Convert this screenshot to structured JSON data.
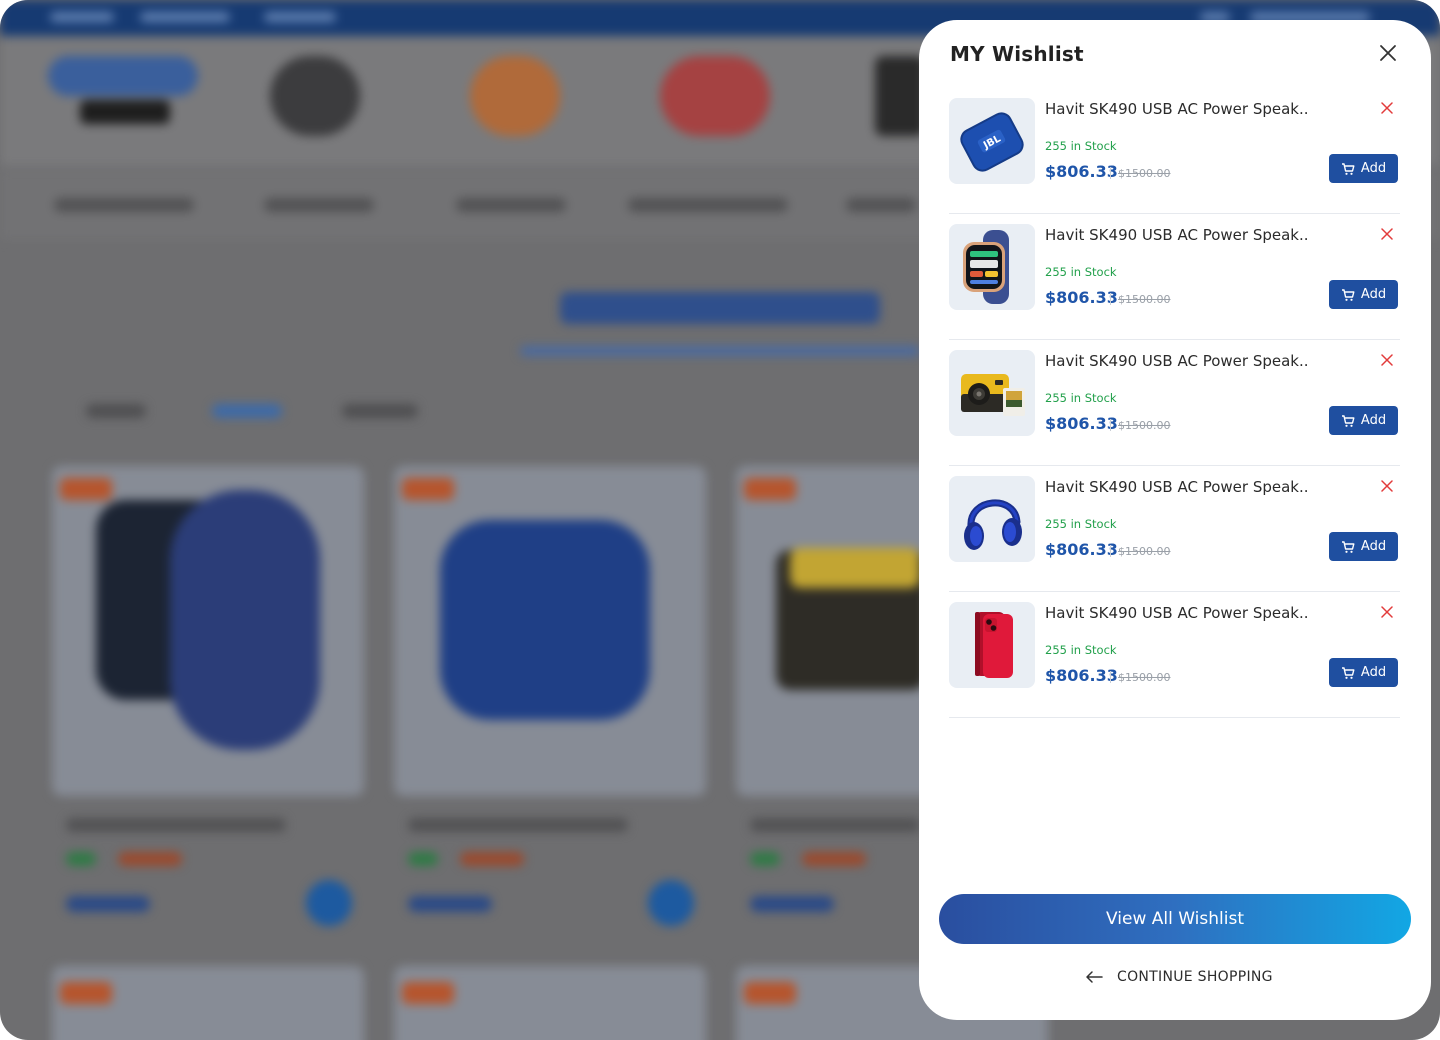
{
  "wishlist": {
    "title": "MY Wishlist",
    "close_icon": "close-icon",
    "items": [
      {
        "name": "Havit SK490 USB AC Power Speak..",
        "stock": "255 in Stock",
        "price": "$806.33",
        "old_price": "$1500.00",
        "add_label": "Add",
        "image": "blue-speaker"
      },
      {
        "name": "Havit SK490 USB AC Power Speak..",
        "stock": "255 in Stock",
        "price": "$806.33",
        "old_price": "$1500.00",
        "add_label": "Add",
        "image": "smartwatch"
      },
      {
        "name": "Havit SK490 USB AC Power Speak..",
        "stock": "255 in Stock",
        "price": "$806.33",
        "old_price": "$1500.00",
        "add_label": "Add",
        "image": "yellow-camera"
      },
      {
        "name": "Havit SK490 USB AC Power Speak..",
        "stock": "255 in Stock",
        "price": "$806.33",
        "old_price": "$1500.00",
        "add_label": "Add",
        "image": "blue-headphones"
      },
      {
        "name": "Havit SK490 USB AC Power Speak..",
        "stock": "255 in Stock",
        "price": "$806.33",
        "old_price": "$1500.00",
        "add_label": "Add",
        "image": "red-phone"
      }
    ],
    "view_all_label": "View All Wishlist",
    "continue_label": "CONTINUE SHOPPING"
  },
  "colors": {
    "accent_blue": "#1f4fa0",
    "price_blue": "#1f55a9",
    "stock_green": "#22a04b",
    "remove_red": "#e23b3b",
    "gradient_start": "#2a4e9f",
    "gradient_end": "#12a7e4"
  }
}
